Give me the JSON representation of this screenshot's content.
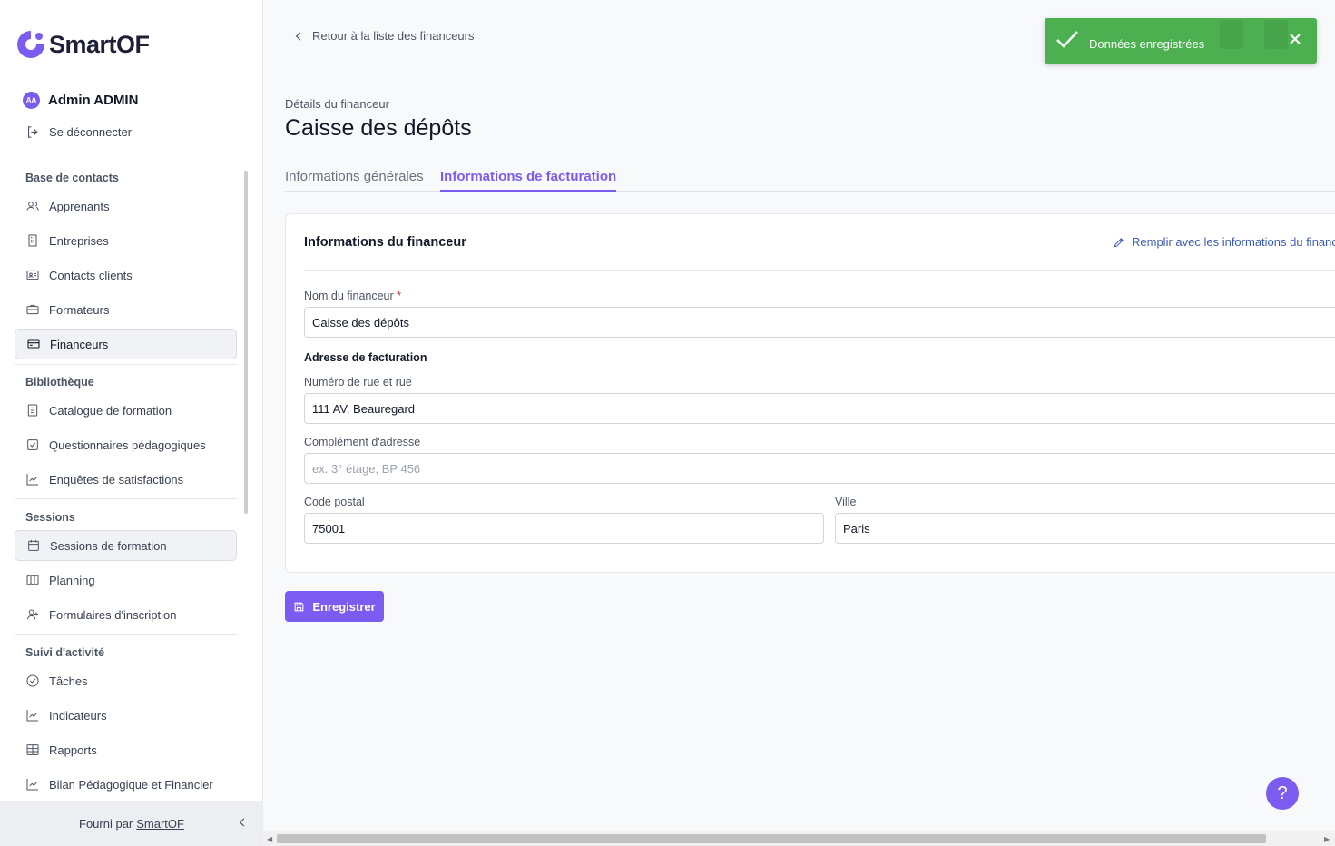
{
  "brand": {
    "name": "SmartOF",
    "accent": "#7c5cf0"
  },
  "user": {
    "initials": "AA",
    "name": "Admin ADMIN",
    "logout_label": "Se déconnecter"
  },
  "sidebar": {
    "sections": [
      {
        "title": "Base de contacts",
        "items": [
          {
            "label": "Apprenants",
            "icon": "users-icon"
          },
          {
            "label": "Entreprises",
            "icon": "building-icon"
          },
          {
            "label": "Contacts clients",
            "icon": "contact-card-icon"
          },
          {
            "label": "Formateurs",
            "icon": "briefcase-icon"
          },
          {
            "label": "Financeurs",
            "icon": "credit-card-icon",
            "active": true
          }
        ]
      },
      {
        "title": "Bibliothèque",
        "items": [
          {
            "label": "Catalogue de formation",
            "icon": "book-icon"
          },
          {
            "label": "Questionnaires pédagogiques",
            "icon": "checkbox-icon"
          },
          {
            "label": "Enquêtes de satisfactions",
            "icon": "chart-line-icon"
          }
        ]
      },
      {
        "title": "Sessions",
        "items": [
          {
            "label": "Sessions de formation",
            "icon": "calendar-icon",
            "active": true
          },
          {
            "label": "Planning",
            "icon": "map-icon"
          },
          {
            "label": "Formulaires d'inscription",
            "icon": "user-plus-icon"
          }
        ]
      },
      {
        "title": "Suivi d'activité",
        "items": [
          {
            "label": "Tâches",
            "icon": "check-circle-icon"
          },
          {
            "label": "Indicateurs",
            "icon": "chart-line-icon"
          },
          {
            "label": "Rapports",
            "icon": "table-icon"
          },
          {
            "label": "Bilan Pédagogique et Financier",
            "icon": "chart-line-icon"
          }
        ]
      }
    ],
    "footer_prefix": "Fourni par",
    "footer_link": "SmartOF"
  },
  "main": {
    "back_label": "Retour à la liste des financeurs",
    "subtitle": "Détails du financeur",
    "title": "Caisse des dépôts",
    "tabs": [
      {
        "label": "Informations générales",
        "active": false
      },
      {
        "label": "Informations de facturation",
        "active": true
      }
    ],
    "card": {
      "title": "Informations du financeur",
      "fill_link": "Remplir avec les informations du financeur",
      "name_label": "Nom du financeur",
      "required_mark": "*",
      "name_value": "Caisse des dépôts",
      "address_group": "Adresse de facturation",
      "street_label": "Numéro de rue et rue",
      "street_value": "111 AV. Beauregard",
      "complement_label": "Complément d'adresse",
      "complement_placeholder": "ex. 3° étage, BP 456",
      "postal_label": "Code postal",
      "postal_value": "75001",
      "city_label": "Ville",
      "city_value": "Paris"
    },
    "save_label": "Enregistrer"
  },
  "toast": {
    "message": "Données enregistrées",
    "color": "#4caf50"
  },
  "help": {
    "label": "?"
  }
}
